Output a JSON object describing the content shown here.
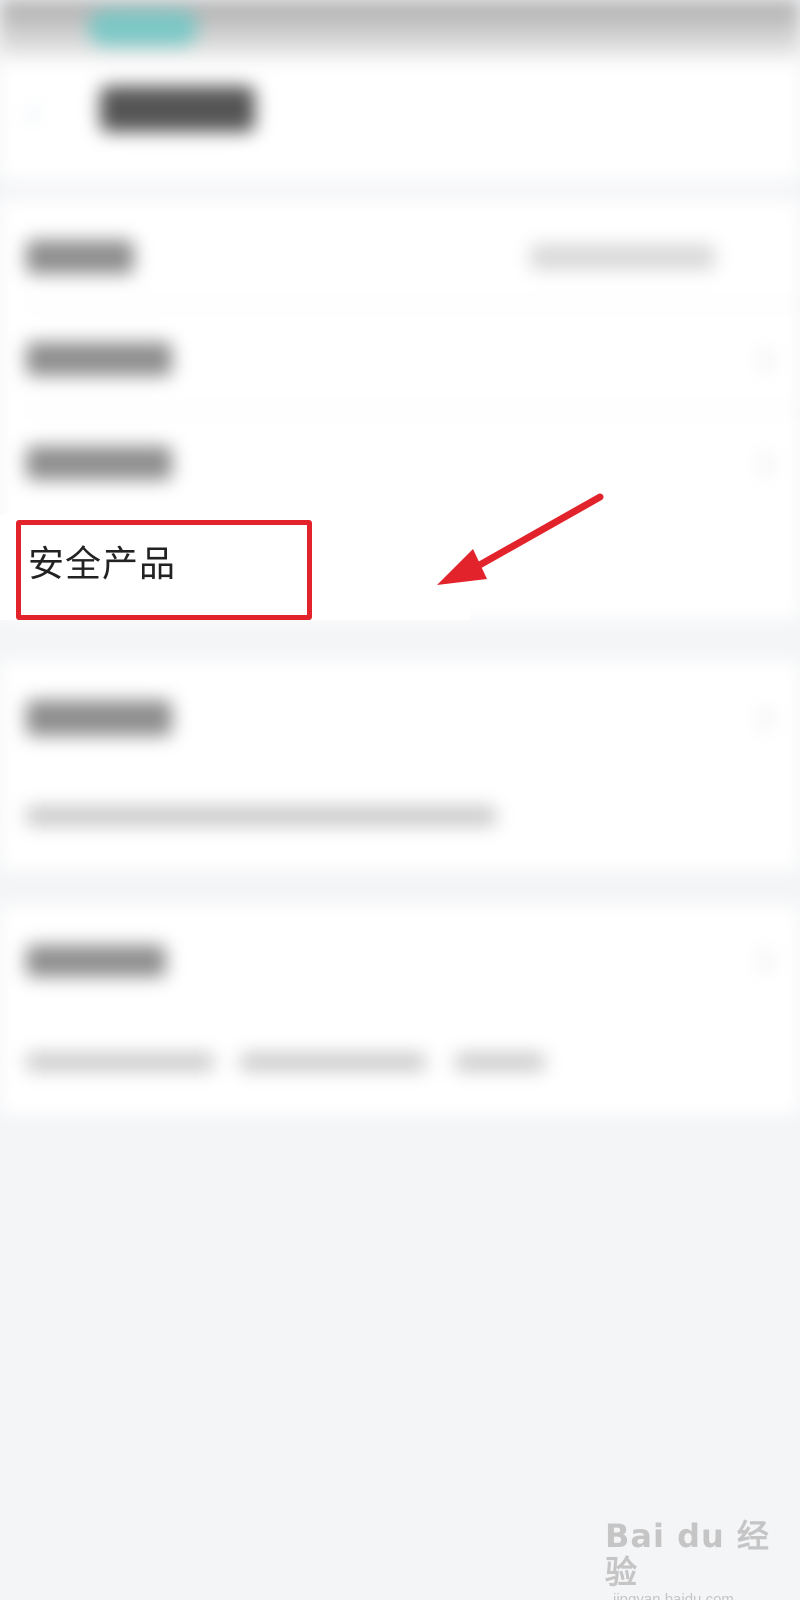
{
  "settings_list": {
    "highlighted_item": {
      "label": "安全产品"
    }
  },
  "annotation": {
    "highlight_color": "#e3232b",
    "arrow_color": "#e3232b"
  },
  "watermark": {
    "main": "Bai du 经验",
    "sub": "jingyan.baidu.com"
  },
  "colors": {
    "background": "#f4f5f7",
    "row_background": "#ffffff",
    "status_accent": "#7cc8c6"
  }
}
